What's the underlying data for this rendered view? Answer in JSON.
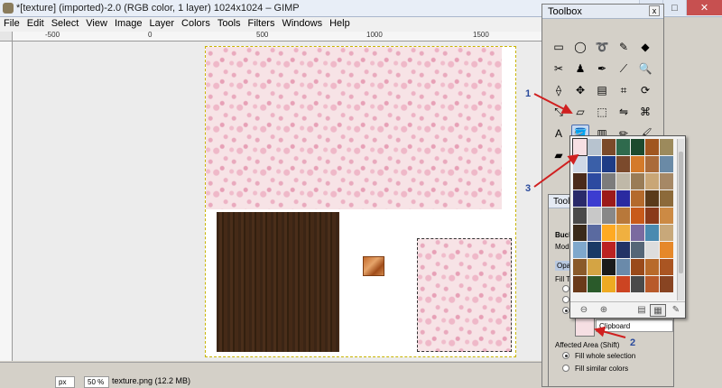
{
  "window": {
    "title": "*[texture] (imported)-2.0 (RGB color, 1 layer) 1024x1024 – GIMP",
    "minimize": "–",
    "maximize": "□",
    "close": "✕"
  },
  "menus": [
    "File",
    "Edit",
    "Select",
    "View",
    "Image",
    "Layer",
    "Colors",
    "Tools",
    "Filters",
    "Windows",
    "Help"
  ],
  "ruler": {
    "labels": [
      "-500",
      "0",
      "500",
      "1000",
      "1500"
    ]
  },
  "statusbar": {
    "unit": "px",
    "zoom": "50 %",
    "info": "texture.png (12.2 MB)"
  },
  "toolbox": {
    "title": "Toolbox",
    "close": "x",
    "tools": [
      {
        "name": "rect-select-icon",
        "glyph": "▭"
      },
      {
        "name": "ellipse-select-icon",
        "glyph": "◯"
      },
      {
        "name": "lasso-icon",
        "glyph": "➰"
      },
      {
        "name": "fuzzy-select-icon",
        "glyph": "✎"
      },
      {
        "name": "color-select-icon",
        "glyph": "◆"
      },
      {
        "name": "scissors-icon",
        "glyph": "✂"
      },
      {
        "name": "foreground-select-icon",
        "glyph": "♟"
      },
      {
        "name": "paths-icon",
        "glyph": "✒"
      },
      {
        "name": "color-picker-icon",
        "glyph": "⟋"
      },
      {
        "name": "zoom-icon",
        "glyph": "🔍"
      },
      {
        "name": "measure-icon",
        "glyph": "⟠"
      },
      {
        "name": "move-icon",
        "glyph": "✥"
      },
      {
        "name": "align-icon",
        "glyph": "▤"
      },
      {
        "name": "crop-icon",
        "glyph": "⌗"
      },
      {
        "name": "rotate-icon",
        "glyph": "⟳"
      },
      {
        "name": "scale-icon",
        "glyph": "⤡"
      },
      {
        "name": "shear-icon",
        "glyph": "▱"
      },
      {
        "name": "perspective-icon",
        "glyph": "⬚"
      },
      {
        "name": "flip-icon",
        "glyph": "⇋"
      },
      {
        "name": "cage-icon",
        "glyph": "⌘"
      },
      {
        "name": "text-icon",
        "glyph": "A"
      },
      {
        "name": "bucket-fill-icon",
        "glyph": "🪣"
      },
      {
        "name": "blend-icon",
        "glyph": "▥"
      },
      {
        "name": "pencil-icon",
        "glyph": "✏"
      },
      {
        "name": "paintbrush-icon",
        "glyph": "🖌"
      },
      {
        "name": "eraser-icon",
        "glyph": "▰"
      }
    ]
  },
  "tool_options": {
    "title": "Tool O",
    "tool_name": "Bucket",
    "mode_label": "Mode:",
    "opacity_label": "Opacit",
    "fill_type_label": "Fill Type",
    "pattern_name": "Clipboard",
    "affected_area_label": "Affected Area  (Shift)",
    "fill_whole": "Fill whole selection",
    "fill_similar": "Fill similar colors"
  },
  "pattern_popup": {
    "patterns": [
      "#f6dfe3",
      "#b7c3cf",
      "#7b4a2a",
      "#2f6a4d",
      "#1c4a2e",
      "#a0561f",
      "#9c8a5c",
      "#cfd8e6",
      "#3a5fa8",
      "#1e3c86",
      "#7b4a2c",
      "#d47a2a",
      "#aa6b3a",
      "#6a8aa6",
      "#4a2a1a",
      "#2c4aa0",
      "#7c7c7c",
      "#bfb8a8",
      "#9a7c56",
      "#c9a676",
      "#a68866",
      "#2a2a6a",
      "#3c3cd0",
      "#9c1a1a",
      "#2a2aa0",
      "#b46a2c",
      "#5a3a1a",
      "#8c6a3a",
      "#4a4a4a",
      "#c8c8c8",
      "#888888",
      "#b8783a",
      "#c85a1a",
      "#8a3a1a",
      "#cc8a44",
      "#3a2a1a",
      "#5a6aa0",
      "#ffaa22",
      "#f0b040",
      "#7a6aa0",
      "#4a8ab0",
      "#c8a87a",
      "#7fa8cc",
      "#1a3a66",
      "#bb2222",
      "#223366",
      "#556677",
      "#dddddd",
      "#e6882a",
      "#8a5a2a",
      "#d4a444",
      "#1a1a1a",
      "#6a8aaa",
      "#9a4a1a",
      "#b86a2a",
      "#aa5522",
      "#6a3a1a",
      "#2a5a2a",
      "#eeaa22",
      "#cc4422",
      "#4a4a4a",
      "#b85a2a",
      "#884422"
    ],
    "btn_zoom_out": "⊖",
    "btn_zoom_in": "⊕",
    "btn_list": "▤",
    "btn_grid": "▦",
    "btn_edit": "✎"
  },
  "annotations": [
    "1",
    "2",
    "3"
  ]
}
